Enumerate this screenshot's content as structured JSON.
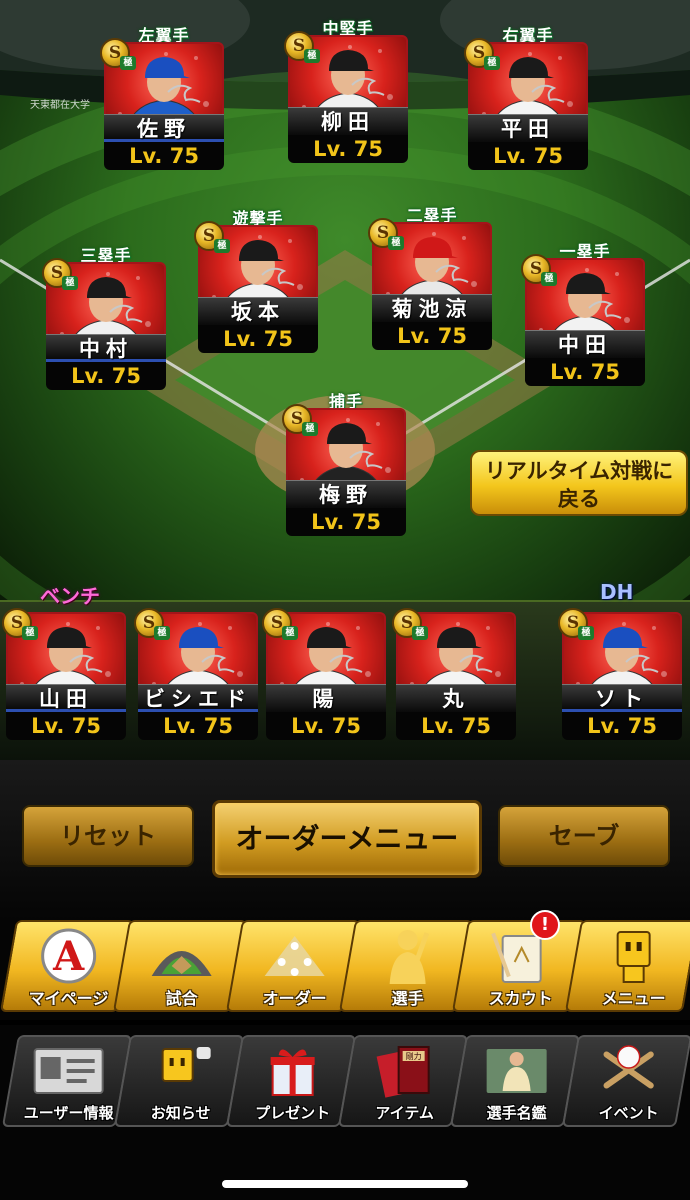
{
  "field_players": [
    {
      "position": "左翼手",
      "name": "佐野",
      "level": "Lv. 75"
    },
    {
      "position": "中堅手",
      "name": "柳田",
      "level": "Lv. 75"
    },
    {
      "position": "右翼手",
      "name": "平田",
      "level": "Lv. 75"
    },
    {
      "position": "遊撃手",
      "name": "坂本",
      "level": "Lv. 75"
    },
    {
      "position": "二塁手",
      "name": "菊池涼",
      "level": "Lv. 75"
    },
    {
      "position": "三塁手",
      "name": "中村",
      "level": "Lv. 75"
    },
    {
      "position": "一塁手",
      "name": "中田",
      "level": "Lv. 75"
    },
    {
      "position": "捕手",
      "name": "梅野",
      "level": "Lv. 75"
    }
  ],
  "badge": {
    "letter": "S",
    "sub": "極"
  },
  "return_button": {
    "line1": "リアルタイム対戦に",
    "line2": "戻る"
  },
  "bench": {
    "label": "ベンチ",
    "players": [
      {
        "name": "山田",
        "level": "Lv. 75"
      },
      {
        "name": "ビシエド",
        "level": "Lv. 75"
      },
      {
        "name": "陽",
        "level": "Lv. 75"
      },
      {
        "name": "丸",
        "level": "Lv. 75"
      }
    ]
  },
  "dh": {
    "label": "DH",
    "name": "ソト",
    "level": "Lv. 75"
  },
  "order_bar": {
    "reset": "リセット",
    "order_menu": "オーダーメニュー",
    "save": "セーブ"
  },
  "main_menu": [
    {
      "label": "マイページ",
      "icon": "mypage-icon"
    },
    {
      "label": "試合",
      "icon": "stadium-icon"
    },
    {
      "label": "オーダー",
      "icon": "order-icon"
    },
    {
      "label": "選手",
      "icon": "player-icon"
    },
    {
      "label": "スカウト",
      "icon": "scout-icon"
    },
    {
      "label": "メニュー",
      "icon": "menu-icon"
    }
  ],
  "scout_notification": "!",
  "sub_menu": [
    {
      "label": "ユーザー情報",
      "icon": "user-info-icon"
    },
    {
      "label": "お知らせ",
      "icon": "news-icon"
    },
    {
      "label": "プレゼント",
      "icon": "present-icon"
    },
    {
      "label": "アイテム",
      "icon": "item-icon"
    },
    {
      "label": "選手名鑑",
      "icon": "player-directory-icon"
    },
    {
      "label": "イベント",
      "icon": "event-icon"
    }
  ],
  "item_book_text": "剛力",
  "colors": {
    "card_red": "#d8221c",
    "level_gold": "#f2c419",
    "menu_gold": "#f1b721"
  }
}
